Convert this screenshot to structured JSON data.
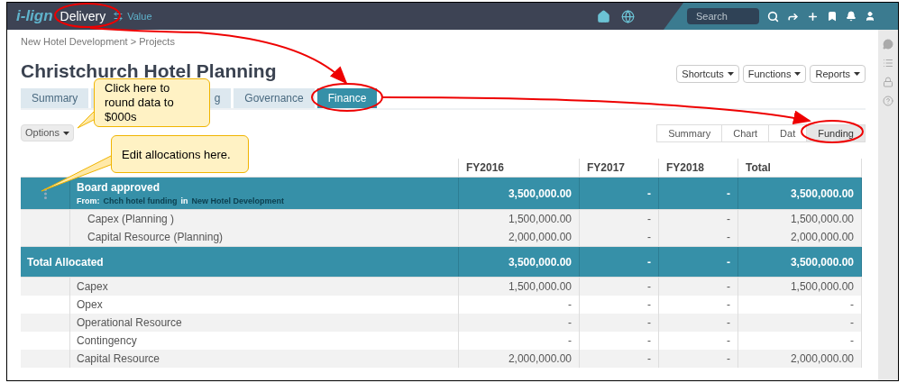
{
  "app": {
    "logo": "i-lign"
  },
  "nav": [
    {
      "label": "Delivery",
      "selected": true
    },
    {
      "label": "Value",
      "selected": false
    }
  ],
  "search": {
    "placeholder": "Search"
  },
  "breadcrumb": "New Hotel Development > Projects",
  "title": "Christchurch Hotel Planning",
  "menus": [
    "Shortcuts",
    "Functions",
    "Reports"
  ],
  "tabs": [
    {
      "label": "Summary",
      "selected": false
    },
    {
      "label": "g",
      "selected": false
    },
    {
      "label": "Governance",
      "selected": false
    },
    {
      "label": "Finance",
      "selected": true
    }
  ],
  "options": "Options",
  "views": [
    {
      "label": "Summary",
      "selected": false
    },
    {
      "label": "Chart",
      "selected": false
    },
    {
      "label": "Dat",
      "selected": false
    },
    {
      "label": "Funding",
      "selected": true
    }
  ],
  "table": {
    "columns": [
      "FY2016",
      "FY2017",
      "FY2018",
      "Total"
    ],
    "rows": [
      {
        "kind": "approved",
        "label": "Board approved",
        "from_label": "From:",
        "source": "Chch hotel funding",
        "joiner": "in",
        "project": "New Hotel Development",
        "values": [
          "3,500,000.00",
          "-",
          "-",
          "3,500,000.00"
        ]
      },
      {
        "kind": "sub",
        "label": "Capex (Planning )",
        "values": [
          "1,500,000.00",
          "-",
          "-",
          "1,500,000.00"
        ]
      },
      {
        "kind": "sub",
        "label": "Capital Resource (Planning)",
        "values": [
          "2,000,000.00",
          "-",
          "-",
          "2,000,000.00"
        ]
      },
      {
        "kind": "total",
        "label": "Total Allocated",
        "values": [
          "3,500,000.00",
          "-",
          "-",
          "3,500,000.00"
        ]
      },
      {
        "kind": "line",
        "label": "Capex",
        "values": [
          "1,500,000.00",
          "-",
          "-",
          "1,500,000.00"
        ]
      },
      {
        "kind": "line",
        "label": "Opex",
        "values": [
          "-",
          "-",
          "-",
          "-"
        ]
      },
      {
        "kind": "line",
        "label": "Operational Resource",
        "values": [
          "-",
          "-",
          "-",
          "-"
        ]
      },
      {
        "kind": "line",
        "label": "Contingency",
        "values": [
          "-",
          "-",
          "-",
          "-"
        ]
      },
      {
        "kind": "line",
        "label": "Capital Resource",
        "values": [
          "2,000,000.00",
          "-",
          "-",
          "2,000,000.00"
        ]
      }
    ]
  },
  "callouts": [
    {
      "text": "Click here to round data to $000s"
    },
    {
      "text": "Edit allocations here."
    }
  ]
}
